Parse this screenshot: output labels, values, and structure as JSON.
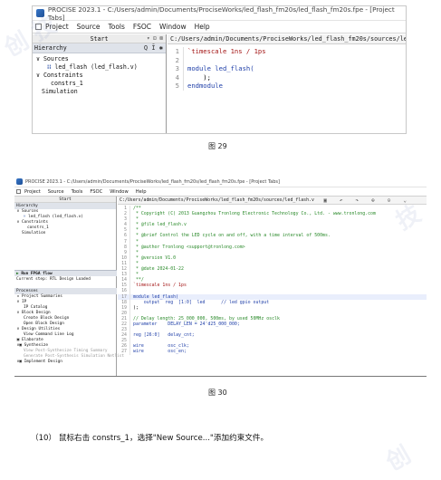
{
  "fig29": {
    "window_title": "PROCISE 2023.1 - C:/Users/admin/Documents/ProciseWorks/led_flash_fm20s/led_flash_fm20s.fpe - [Project Tabs]",
    "menu": [
      "Project",
      "Source",
      "Tools",
      "FSOC",
      "Window",
      "Help"
    ],
    "start_label": "Start",
    "hierarchy_label": "Hierarchy",
    "tree": {
      "sources": "Sources",
      "file": "led_flash (led_flash.v)",
      "constraints": "Constraints",
      "constr": "constrs_1",
      "simulation": "Simulation"
    },
    "editor_path": "C:/Users/admin/Documents/ProciseWorks/led_flash_fm20s/sources/led_flash.v",
    "code": [
      {
        "n": "1",
        "text": "`timescale 1ns / 1ps"
      },
      {
        "n": "2",
        "text": ""
      },
      {
        "n": "3",
        "text": "module led_flash("
      },
      {
        "n": "4",
        "text": "    );"
      },
      {
        "n": "5",
        "text": "endmodule"
      }
    ],
    "caption": "图 29"
  },
  "fig30": {
    "window_title": "PROCISE 2023.1 - C:/Users/admin/Documents/ProciseWorks/led_flash_fm20s/led_flash_fm20s.fpe - [Project Tabs]",
    "menu": [
      "Project",
      "Source",
      "Tools",
      "FSOC",
      "Window",
      "Help"
    ],
    "start_label": "Start",
    "hierarchy_label": "Hierarchy",
    "tree": {
      "sources": "Sources",
      "file": "led_flash (led_flash.v)",
      "constraints": "Constraints",
      "constr": "constrs_1",
      "simulation": "Simulation"
    },
    "flow_header": "Run FPGA flow",
    "design_loaded": "Current step: RTL Design Loaded",
    "processes_label": "Processes",
    "processes": [
      "Project Summaries",
      "IP",
      "IP Catalog",
      "Block Design",
      "Create Block Design",
      "Open Block Design",
      "Design Utilities",
      "View Command Line Log",
      "Elaborate",
      "Synthesize",
      "View Post-Synthesize Timing Summary",
      "Generate Post-Synthesis Simulation Netlist",
      "Implement Design"
    ],
    "editor_path": "C:/Users/admin/Documents/ProciseWorks/led_flash_fm20s/sources/led_flash.v",
    "code": [
      {
        "n": "1",
        "text": "/**"
      },
      {
        "n": "2",
        "text": " * Copyright (C) 2013 Guangzhou Tronlong Electronic Technology Co., Ltd. - www.tronlong.com"
      },
      {
        "n": "3",
        "text": " *"
      },
      {
        "n": "4",
        "text": " * @file led_flash.v"
      },
      {
        "n": "5",
        "text": " *"
      },
      {
        "n": "6",
        "text": " * @brief Control the LED cycle on and off, with a time interval of 500ms."
      },
      {
        "n": "7",
        "text": " *"
      },
      {
        "n": "8",
        "text": " * @author Tronlong <support@tronlong.com>"
      },
      {
        "n": "9",
        "text": " *"
      },
      {
        "n": "10",
        "text": " * @version V1.0"
      },
      {
        "n": "11",
        "text": " *"
      },
      {
        "n": "12",
        "text": " * @date 2024-01-22"
      },
      {
        "n": "13",
        "text": " *"
      },
      {
        "n": "14",
        "text": " **/"
      },
      {
        "n": "15",
        "text": "`timescale 1ns / 1ps"
      },
      {
        "n": "16",
        "text": ""
      },
      {
        "n": "17",
        "text": "module led_flash("
      },
      {
        "n": "18",
        "text": "    output  reg  [1:0]  led      // led gpio output"
      },
      {
        "n": "19",
        "text": ");"
      },
      {
        "n": "20",
        "text": ""
      },
      {
        "n": "21",
        "text": "// Delay length: 25_000_000, 500ms, by used 50MHz osclk"
      },
      {
        "n": "22",
        "text": "parameter    DELAY_LEN = 24'd25_000_000;"
      },
      {
        "n": "23",
        "text": ""
      },
      {
        "n": "24",
        "text": "reg [26:0]   delay_cnt;"
      },
      {
        "n": "25",
        "text": ""
      },
      {
        "n": "26",
        "text": "wire         osc_clk;"
      },
      {
        "n": "27",
        "text": "wire         osc_en;"
      }
    ],
    "caption": "图 30"
  },
  "step_text": "（10） 鼠标右击 constrs_1，选择\"New Source...\"添加约束文件。"
}
